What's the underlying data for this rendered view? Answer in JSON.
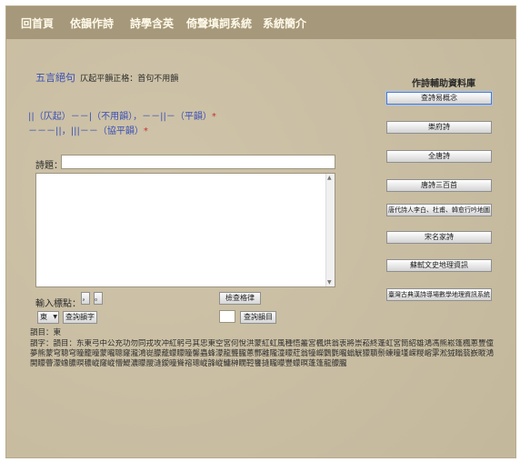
{
  "nav": {
    "items": [
      "回首頁",
      "依韻作詩",
      "詩學含英",
      "倚聲填詞系統",
      "系統簡介"
    ]
  },
  "form": {
    "type_label": "五言絕句",
    "rule_label": "仄起平韻正格：首句不用韻",
    "pattern_line1_prefix": "||（仄起）－－|（不用韻），－－||－（平韻）",
    "pattern_line1_star": "*",
    "pattern_line2_prefix": "－－－||，|||－－（協平韻）",
    "pattern_line2_star": "*",
    "title_label": "詩題：",
    "title_value": "",
    "poem_value": "",
    "punct_label": "輸入標點：",
    "punct_buttons": [
      "，",
      "。"
    ],
    "check_button": "檢查格律",
    "rhyme_select": "東",
    "query_rhyme_button": "查詢韻字",
    "query_group_button": "查詢韻目",
    "group_input_value": ""
  },
  "result": {
    "rhyme_group": "韻目：東",
    "rhyme_chars": "韻字：韻目：东東弓中公充功勿同戎攻冲紅躬弓其忠東空宮何悅洪蒙紅虹風種悟叢宮楓烘翁衷將崇菘終蓬虹宮筒紹雄鴻馮熊崧篷楓蔥豐僮夢熊蒙穹聰穹瞳籠曈蒙曨聰窿瀧鴻嵸朦蘢蠓矇瞳馨蟲蜂濛龍聾朧蔥酆雝隴潼曚葒翁犝嶸鸏氋曨螉觥獴聵鬃蝀曈墐嵘糉嵱雺淞狨瞈蓊嶔瞛鴻閧矇瞢濛蟓膿暝穠嵷窿嵷懵鯷濃矇鬷漨鑀曈聳褣璁嵷韸嵷鱅榊瞯鞚饔摓矓曚豐蠓暝蓬篷龍艨朧"
  },
  "sidebar": {
    "title": "作詩輔助資料庫",
    "buttons": [
      "查詩易概念",
      "樂府詩",
      "全唐詩",
      "唐詩三百首",
      "唐代詩人李白、杜甫、韓愈行吟地圖",
      "宋名家詩",
      "蘇軾文史地理資訊",
      "臺灣古典漢詩導場數學地理資訊系統"
    ]
  }
}
